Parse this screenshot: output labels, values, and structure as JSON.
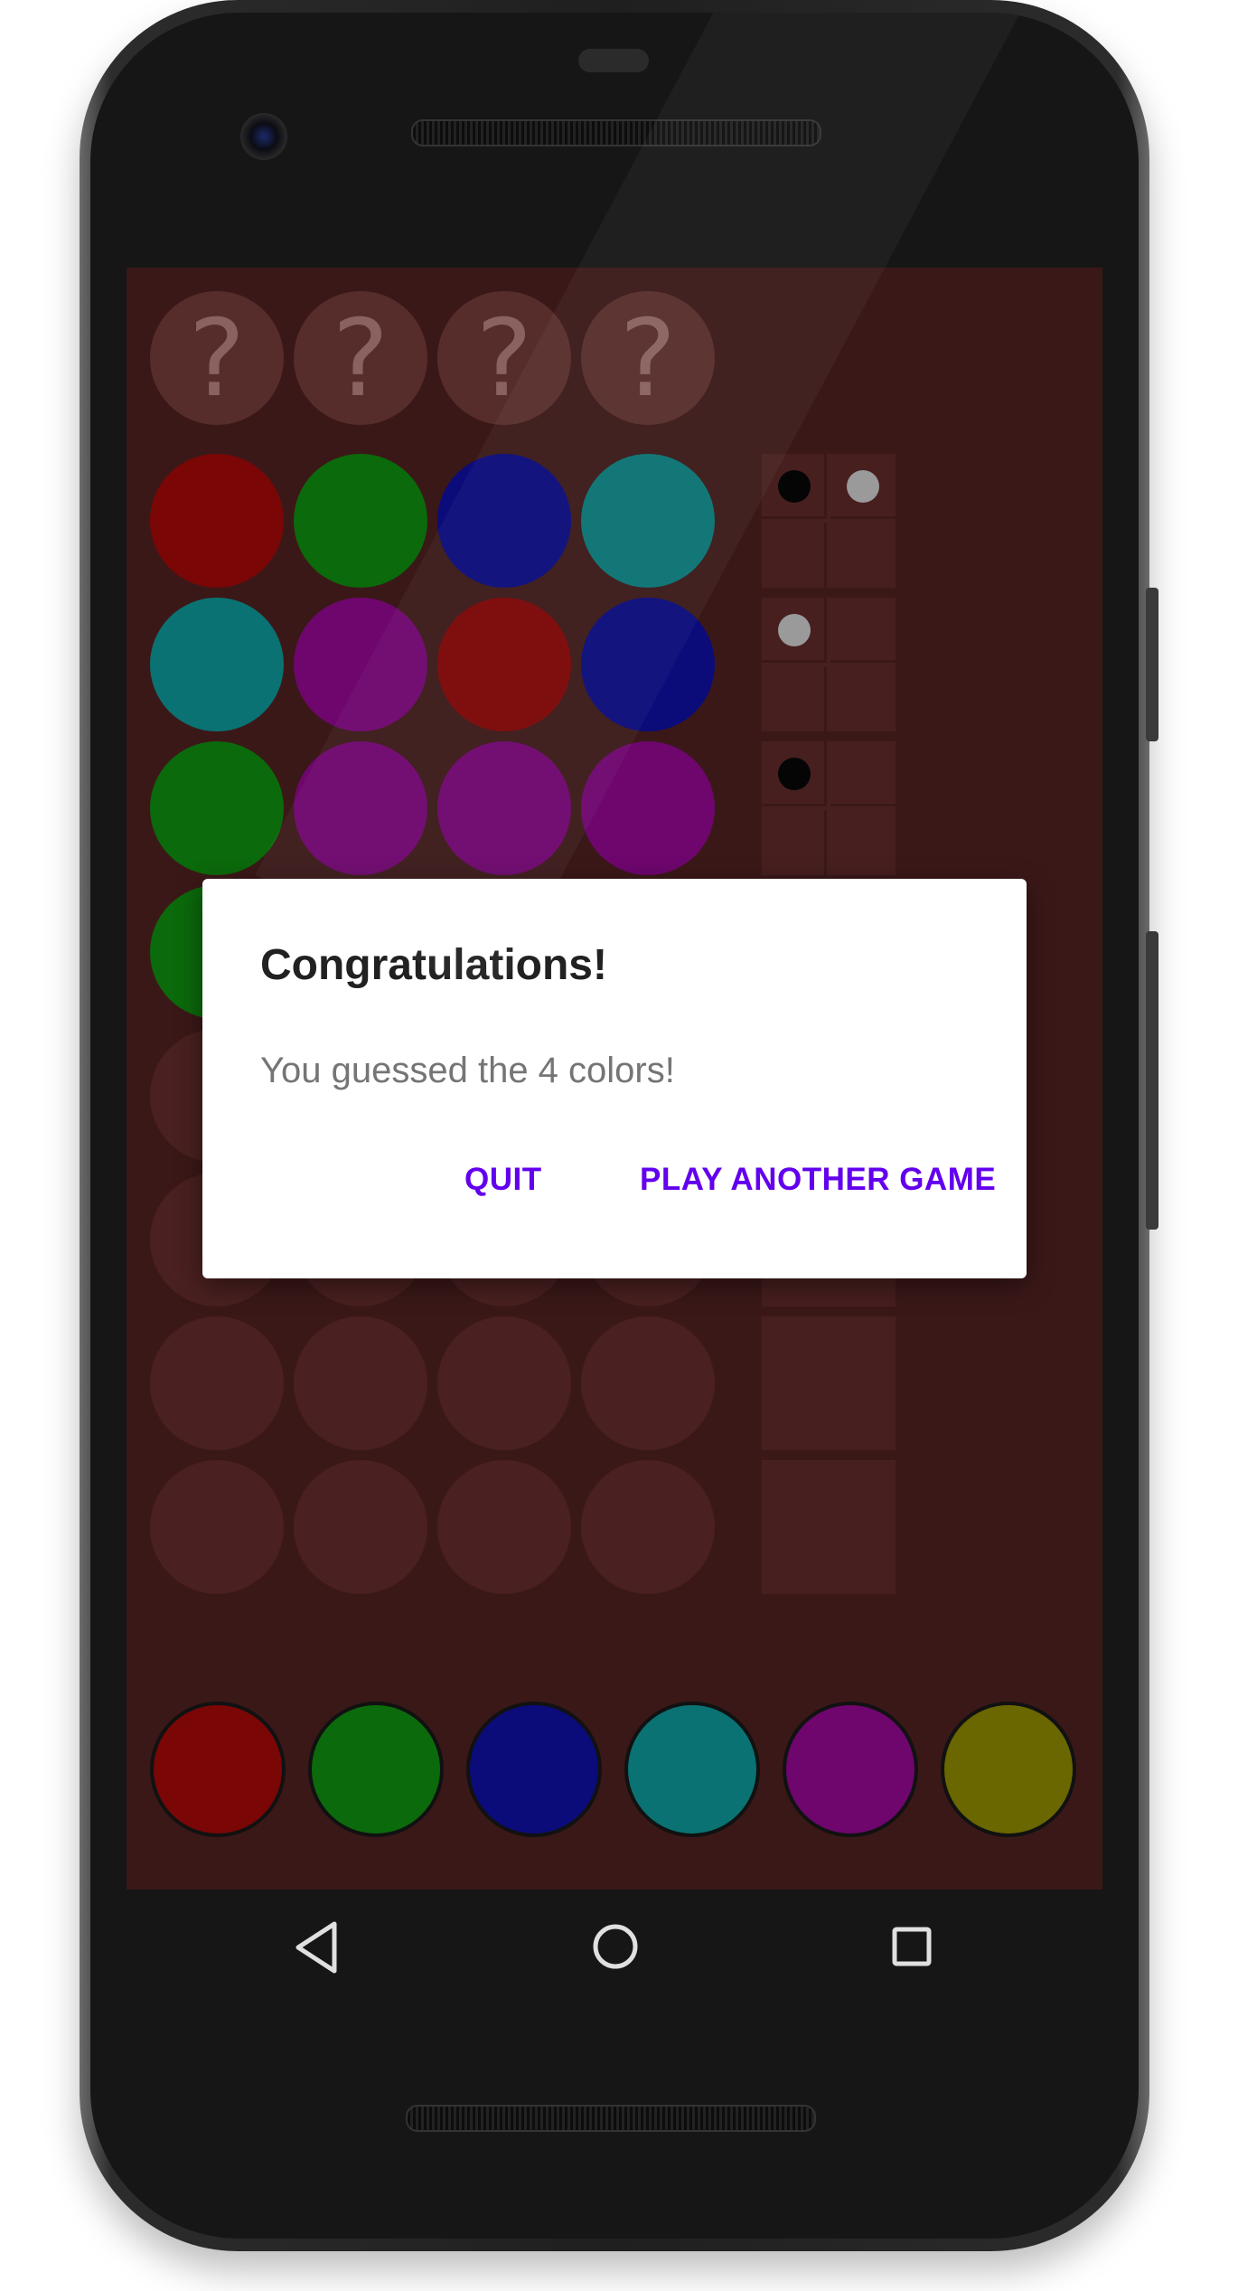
{
  "dialog": {
    "title": "Congratulations!",
    "message": "You guessed the 4 colors!",
    "quit_label": "QUIT",
    "play_again_label": "PLAY ANOTHER GAME"
  },
  "secret_row": [
    "?",
    "?",
    "?",
    "?"
  ],
  "guess_rows": [
    {
      "pegs": [
        "red",
        "green",
        "blue",
        "cyan"
      ],
      "feedback": [
        "black",
        "white",
        "",
        ""
      ]
    },
    {
      "pegs": [
        "cyan",
        "purple",
        "red",
        "blue"
      ],
      "feedback": [
        "white",
        "",
        "",
        ""
      ]
    },
    {
      "pegs": [
        "green",
        "purple",
        "purple",
        "purple"
      ],
      "feedback": [
        "black",
        "",
        "",
        ""
      ]
    },
    {
      "pegs": [
        "green",
        "",
        "",
        ""
      ],
      "feedback": [
        "",
        "",
        "",
        ""
      ]
    },
    {
      "pegs": [
        "",
        "",
        "",
        ""
      ],
      "feedback": [
        "",
        "",
        "",
        ""
      ]
    },
    {
      "pegs": [
        "",
        "",
        "",
        ""
      ],
      "feedback": [
        "",
        "",
        "",
        ""
      ]
    },
    {
      "pegs": [
        "",
        "",
        "",
        ""
      ],
      "feedback": [
        "",
        "",
        "",
        ""
      ]
    },
    {
      "pegs": [
        "",
        "",
        "",
        ""
      ],
      "feedback": [
        "",
        "",
        "",
        ""
      ]
    }
  ],
  "palette": [
    "red",
    "green",
    "blue",
    "cyan",
    "purple",
    "yellow"
  ],
  "colors": {
    "screen_bg": "#3b1818",
    "red": "#7a0606",
    "green": "#0b6a0b",
    "blue": "#0b0b7a",
    "cyan": "#0a7272",
    "purple": "#6e066e",
    "yellow": "#6a6600",
    "feedback_black": "#050505",
    "feedback_white": "#9a9a9a",
    "dialog_button": "#6200ee"
  },
  "nav": {
    "back_icon": "back-triangle-icon",
    "home_icon": "home-circle-icon",
    "recents_icon": "recents-square-icon"
  }
}
